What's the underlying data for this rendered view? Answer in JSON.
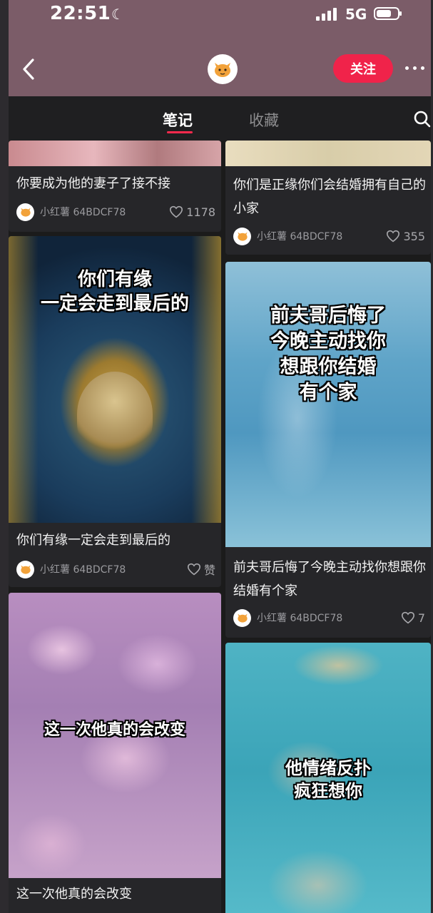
{
  "status_bar": {
    "time": "22:51",
    "network": "5G"
  },
  "header": {
    "follow_label": "关注"
  },
  "tabs": [
    {
      "label": "笔记",
      "active": true
    },
    {
      "label": "收藏",
      "active": false
    }
  ],
  "author_name": "小红薯 64BDCF78",
  "icons": [
    "back-icon",
    "cat-avatar-icon",
    "more-icon",
    "search-icon",
    "heart-icon",
    "moon-icon",
    "signal-icon",
    "battery-icon"
  ],
  "colors": {
    "header_bg": "#7b5c68",
    "accent": "#f0234a",
    "card_bg": "#262629"
  },
  "cards": [
    {
      "title": "你要成为他的妻子了接不接",
      "likes": "1178",
      "overlay": ""
    },
    {
      "title": "你们是正缘你们会结婚拥有自己的小家",
      "likes": "355",
      "overlay": ""
    },
    {
      "title": "你们有缘一定会走到最后的",
      "likes": "赞",
      "overlay_lines": [
        "你们有缘",
        "一定会走到最后的"
      ]
    },
    {
      "title": "前夫哥后悔了今晚主动找你想跟你结婚有个家",
      "likes": "7",
      "overlay_lines": [
        "前夫哥后悔了",
        "今晚主动找你",
        "想跟你结婚",
        "有个家"
      ]
    },
    {
      "title": "这一次他真的会改变",
      "likes": "",
      "overlay_lines": [
        "这一次他真的会改变"
      ]
    },
    {
      "title": "",
      "likes": "",
      "overlay_lines": [
        "他情绪反扑",
        "疯狂想你"
      ]
    }
  ]
}
